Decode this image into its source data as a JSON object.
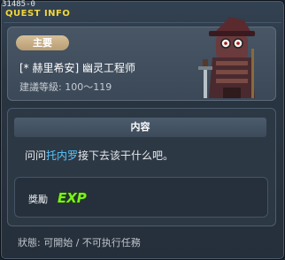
{
  "window": {
    "id_label": "31485-0",
    "title": "QUEST INFO"
  },
  "quest": {
    "category_badge": "主要",
    "name": "[* 赫里希安] 幽灵工程师",
    "level_range": "建議等級: 100～119"
  },
  "content": {
    "header": "内容",
    "text_before": "问问",
    "npc_name": "托内罗",
    "text_after": "接下去该干什么吧。"
  },
  "reward": {
    "label": "獎勵",
    "icon": "exp-icon",
    "icon_text": "EXP"
  },
  "status": {
    "text": "狀態: 可開始 / 不可执行任務"
  },
  "colors": {
    "title": "#f2d63a",
    "npc_link": "#56c8ff",
    "badge": "#c9ae84",
    "exp_fill": "#7cf01e"
  }
}
